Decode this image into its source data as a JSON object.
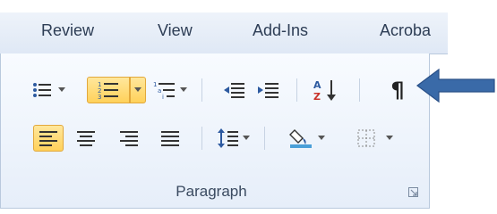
{
  "tabs": [
    {
      "label": "Review"
    },
    {
      "label": "View"
    },
    {
      "label": "Add-Ins"
    },
    {
      "label": "Acroba"
    }
  ],
  "group": {
    "label": "Paragraph"
  },
  "buttons": [
    {
      "icon": "bullets-icon",
      "state": "normal"
    },
    {
      "icon": "numbering-icon",
      "state": "active"
    },
    {
      "icon": "multilevel-list-icon",
      "state": "normal"
    },
    {
      "icon": "decrease-indent-icon",
      "state": "normal"
    },
    {
      "icon": "increase-indent-icon",
      "state": "normal"
    },
    {
      "icon": "sort-icon",
      "state": "normal"
    },
    {
      "icon": "show-hide-formatting-icon",
      "state": "normal",
      "glyph": "¶"
    },
    {
      "icon": "align-left-icon",
      "state": "active"
    },
    {
      "icon": "align-center-icon",
      "state": "normal"
    },
    {
      "icon": "align-right-icon",
      "state": "normal"
    },
    {
      "icon": "justify-icon",
      "state": "normal"
    },
    {
      "icon": "line-spacing-icon",
      "state": "normal"
    },
    {
      "icon": "shading-icon",
      "state": "normal"
    },
    {
      "icon": "borders-icon",
      "state": "normal"
    }
  ],
  "sort_glyph": {
    "a": "A",
    "z": "Z"
  },
  "annotation": {
    "icon": "arrow-left-icon",
    "color": "#3a6aa8"
  },
  "colors": {
    "active_fill": "#ffd15a",
    "active_border": "#e2a83c",
    "icon_blue": "#2d5aa0",
    "icon_dark": "#333333"
  }
}
